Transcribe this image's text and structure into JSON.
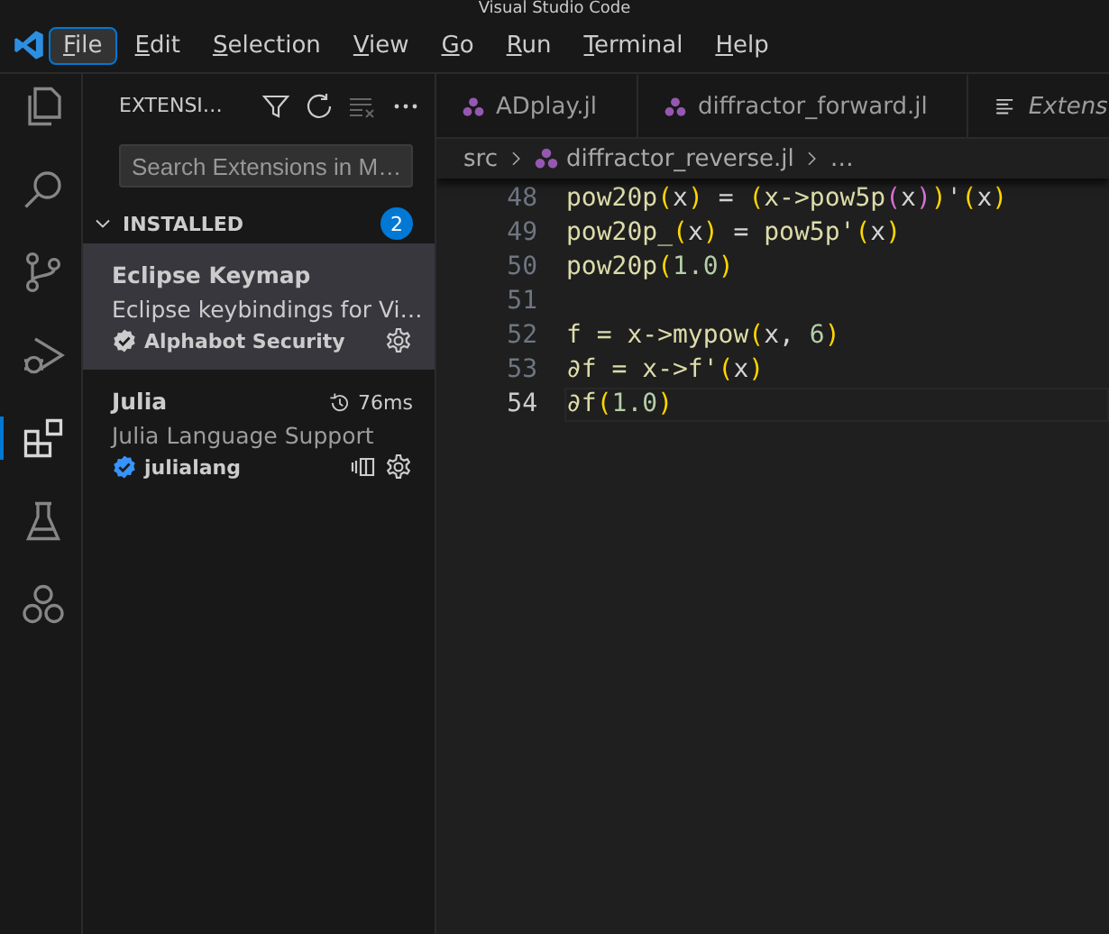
{
  "window": {
    "title": "Visual Studio Code"
  },
  "menu": [
    {
      "label": "File",
      "selected": true
    },
    {
      "label": "Edit",
      "selected": false
    },
    {
      "label": "Selection",
      "selected": false
    },
    {
      "label": "View",
      "selected": false
    },
    {
      "label": "Go",
      "selected": false
    },
    {
      "label": "Run",
      "selected": false
    },
    {
      "label": "Terminal",
      "selected": false
    },
    {
      "label": "Help",
      "selected": false
    }
  ],
  "activity_bar": [
    {
      "kind": "explorer",
      "selected": false
    },
    {
      "kind": "search",
      "selected": false
    },
    {
      "kind": "source-control",
      "selected": false
    },
    {
      "kind": "run-debug",
      "selected": false
    },
    {
      "kind": "extensions",
      "selected": true
    },
    {
      "kind": "testing",
      "selected": false
    },
    {
      "kind": "circles",
      "selected": false
    }
  ],
  "sidebar": {
    "title": "EXTENSI…",
    "search": {
      "placeholder": "Search Extensions in M…"
    },
    "section": {
      "label": "INSTALLED",
      "expanded": true,
      "count": "2"
    },
    "extensions": [
      {
        "name": "Eclipse Keymap",
        "description": "Eclipse keybindings for Vi…",
        "publisher": "Alphabot Security",
        "verified": true,
        "selected": true
      },
      {
        "name": "Julia",
        "description": "Julia Language Support",
        "publisher": "julialang",
        "verified": true,
        "selected": false,
        "activation_time": "76ms"
      }
    ]
  },
  "tabs": [
    {
      "label": "ADplay.jl",
      "kind": "julia",
      "selected": false
    },
    {
      "label": "diffractor_forward.jl",
      "kind": "julia",
      "selected": false
    },
    {
      "label": "Extens",
      "kind": "preview",
      "selected": false
    }
  ],
  "breadcrumb": [
    {
      "label": "src",
      "kind": "folder"
    },
    {
      "label": "diffractor_reverse.jl",
      "kind": "julia"
    },
    {
      "label": "…",
      "kind": "symbol"
    }
  ],
  "code": [
    {
      "number": "48",
      "current": false,
      "tokens": [
        {
          "text": "pow20p",
          "kind": "id"
        },
        {
          "text": "(",
          "kind": "p1"
        },
        {
          "text": "x",
          "kind": "var"
        },
        {
          "text": ")",
          "kind": "p1"
        },
        {
          "text": " = ",
          "kind": "op"
        },
        {
          "text": "(",
          "kind": "p1"
        },
        {
          "text": "x->pow5p",
          "kind": "id"
        },
        {
          "text": "(",
          "kind": "p2"
        },
        {
          "text": "x",
          "kind": "var"
        },
        {
          "text": ")",
          "kind": "p2"
        },
        {
          "text": ")",
          "kind": "p1"
        },
        {
          "text": "'",
          "kind": "op"
        },
        {
          "text": "(",
          "kind": "p1"
        },
        {
          "text": "x",
          "kind": "var"
        },
        {
          "text": ")",
          "kind": "p1"
        }
      ]
    },
    {
      "number": "49",
      "current": false,
      "tokens": [
        {
          "text": "pow20p_",
          "kind": "id"
        },
        {
          "text": "(",
          "kind": "p1"
        },
        {
          "text": "x",
          "kind": "var"
        },
        {
          "text": ")",
          "kind": "p1"
        },
        {
          "text": " = ",
          "kind": "op"
        },
        {
          "text": "pow5p'",
          "kind": "id"
        },
        {
          "text": "(",
          "kind": "p1"
        },
        {
          "text": "x",
          "kind": "var"
        },
        {
          "text": ")",
          "kind": "p1"
        }
      ]
    },
    {
      "number": "50",
      "current": false,
      "tokens": [
        {
          "text": "pow20p",
          "kind": "id"
        },
        {
          "text": "(",
          "kind": "p1"
        },
        {
          "text": "1.0",
          "kind": "num"
        },
        {
          "text": ")",
          "kind": "p1"
        }
      ]
    },
    {
      "number": "51",
      "current": false
    },
    {
      "number": "52",
      "current": false,
      "tokens": [
        {
          "text": "f = x->mypow",
          "kind": "id"
        },
        {
          "text": "(",
          "kind": "p1"
        },
        {
          "text": "x, ",
          "kind": "var"
        },
        {
          "text": "6",
          "kind": "num"
        },
        {
          "text": ")",
          "kind": "p1"
        }
      ]
    },
    {
      "number": "53",
      "current": false,
      "tokens": [
        {
          "text": "∂f = x->f'",
          "kind": "id"
        },
        {
          "text": "(",
          "kind": "p1"
        },
        {
          "text": "x",
          "kind": "var"
        },
        {
          "text": ")",
          "kind": "p1"
        }
      ]
    },
    {
      "number": "54",
      "current": true,
      "tokens": [
        {
          "text": "∂f",
          "kind": "id"
        },
        {
          "text": "(",
          "kind": "p1"
        },
        {
          "text": "1.0",
          "kind": "num"
        },
        {
          "text": ")",
          "kind": "p1"
        }
      ]
    }
  ]
}
